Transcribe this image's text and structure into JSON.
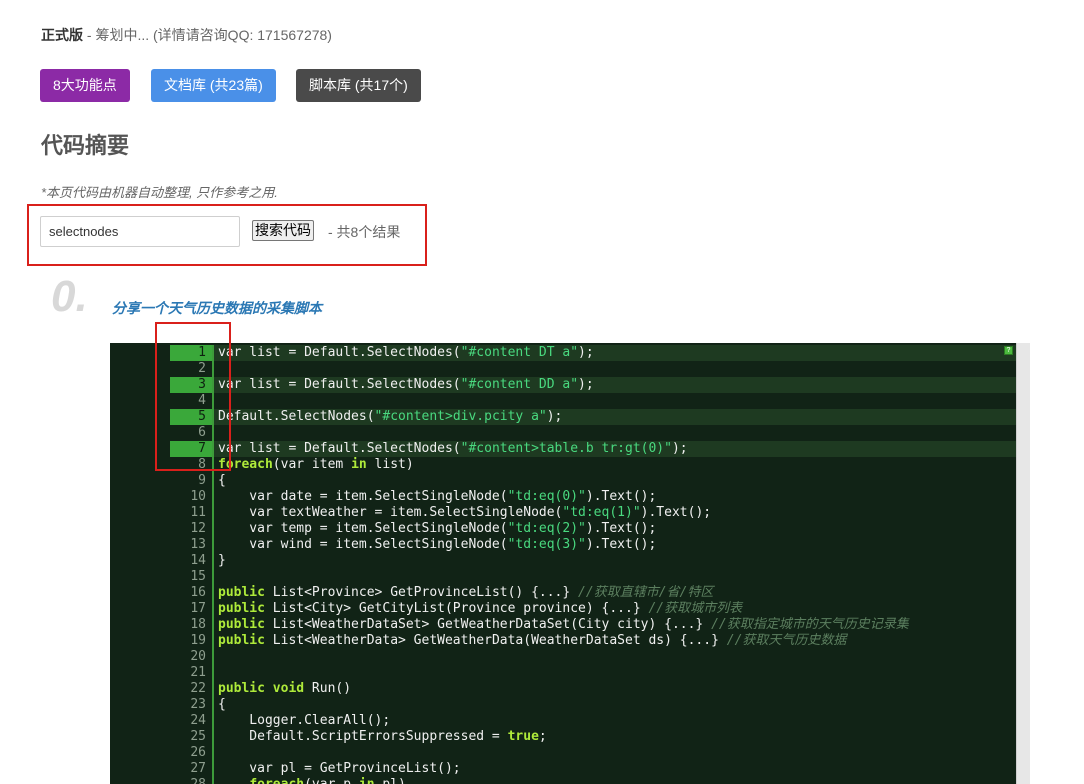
{
  "header": {
    "edition": "正式版",
    "separator": " - ",
    "status": "筹划中... (详情请咨询QQ: 171567278)"
  },
  "buttons": {
    "features": "8大功能点",
    "docs": "文档库 (共23篇)",
    "scripts": "脚本库 (共17个)"
  },
  "section": {
    "title": "代码摘要",
    "note": "*本页代码由机器自动整理, 只作参考之用."
  },
  "search": {
    "value": "selectnodes",
    "button": "搜索代码",
    "result_count": "- 共8个结果"
  },
  "result": {
    "index": "0.",
    "title": "分享一个天气历史数据的采集脚本"
  },
  "colors": {
    "features_btn": "#8c2aa6",
    "docs_btn": "#4a90e8",
    "scripts_btn": "#4a4a4a",
    "code_bg": "#112316",
    "highlight_frame": "#d9201b"
  },
  "code_lines": [
    {
      "n": "1",
      "hl": true,
      "t": [
        [
          "",
          "var list = Default.SelectNodes("
        ],
        [
          "str",
          "\"#content DT a\""
        ],
        [
          "",
          ");"
        ]
      ]
    },
    {
      "n": "2",
      "hl": false,
      "t": []
    },
    {
      "n": "3",
      "hl": true,
      "t": [
        [
          "",
          "var list = Default.SelectNodes("
        ],
        [
          "str",
          "\"#content DD a\""
        ],
        [
          "",
          ");"
        ]
      ]
    },
    {
      "n": "4",
      "hl": false,
      "t": []
    },
    {
      "n": "5",
      "hl": true,
      "t": [
        [
          "",
          "Default.SelectNodes("
        ],
        [
          "str",
          "\"#content>div.pcity a\""
        ],
        [
          "",
          ");"
        ]
      ]
    },
    {
      "n": "6",
      "hl": false,
      "t": []
    },
    {
      "n": "7",
      "hl": true,
      "t": [
        [
          "",
          "var list = Default.SelectNodes("
        ],
        [
          "str",
          "\"#content>table.b tr:gt(0)\""
        ],
        [
          "",
          ");"
        ]
      ]
    },
    {
      "n": "8",
      "hl": false,
      "t": [
        [
          "kw",
          "foreach"
        ],
        [
          "",
          "(var item "
        ],
        [
          "kw",
          "in"
        ],
        [
          "",
          " list)"
        ]
      ]
    },
    {
      "n": "9",
      "hl": false,
      "t": [
        [
          "",
          "{"
        ]
      ]
    },
    {
      "n": "10",
      "hl": false,
      "t": [
        [
          "",
          "    var date = item.SelectSingleNode("
        ],
        [
          "str",
          "\"td:eq(0)\""
        ],
        [
          "",
          ").Text();"
        ]
      ]
    },
    {
      "n": "11",
      "hl": false,
      "t": [
        [
          "",
          "    var textWeather = item.SelectSingleNode("
        ],
        [
          "str",
          "\"td:eq(1)\""
        ],
        [
          "",
          ").Text();"
        ]
      ]
    },
    {
      "n": "12",
      "hl": false,
      "t": [
        [
          "",
          "    var temp = item.SelectSingleNode("
        ],
        [
          "str",
          "\"td:eq(2)\""
        ],
        [
          "",
          ").Text();"
        ]
      ]
    },
    {
      "n": "13",
      "hl": false,
      "t": [
        [
          "",
          "    var wind = item.SelectSingleNode("
        ],
        [
          "str",
          "\"td:eq(3)\""
        ],
        [
          "",
          ").Text();"
        ]
      ]
    },
    {
      "n": "14",
      "hl": false,
      "t": [
        [
          "",
          "}"
        ]
      ]
    },
    {
      "n": "15",
      "hl": false,
      "t": []
    },
    {
      "n": "16",
      "hl": false,
      "t": [
        [
          "kw",
          "public"
        ],
        [
          "",
          " List<Province> GetProvinceList() {...} "
        ],
        [
          "cm",
          "//获取直辖市/省/特区"
        ]
      ]
    },
    {
      "n": "17",
      "hl": false,
      "t": [
        [
          "kw",
          "public"
        ],
        [
          "",
          " List<City> GetCityList(Province province) {...} "
        ],
        [
          "cm",
          "//获取城市列表"
        ]
      ]
    },
    {
      "n": "18",
      "hl": false,
      "t": [
        [
          "kw",
          "public"
        ],
        [
          "",
          " List<WeatherDataSet> GetWeatherDataSet(City city) {...} "
        ],
        [
          "cm",
          "//获取指定城市的天气历史记录集"
        ]
      ]
    },
    {
      "n": "19",
      "hl": false,
      "t": [
        [
          "kw",
          "public"
        ],
        [
          "",
          " List<WeatherData> GetWeatherData(WeatherDataSet ds) {...} "
        ],
        [
          "cm",
          "//获取天气历史数据"
        ]
      ]
    },
    {
      "n": "20",
      "hl": false,
      "t": []
    },
    {
      "n": "21",
      "hl": false,
      "t": []
    },
    {
      "n": "22",
      "hl": false,
      "t": [
        [
          "kw",
          "public void"
        ],
        [
          "",
          " Run()"
        ]
      ]
    },
    {
      "n": "23",
      "hl": false,
      "t": [
        [
          "",
          "{"
        ]
      ]
    },
    {
      "n": "24",
      "hl": false,
      "t": [
        [
          "",
          "    Logger.ClearAll();"
        ]
      ]
    },
    {
      "n": "25",
      "hl": false,
      "t": [
        [
          "",
          "    Default.ScriptErrorsSuppressed = "
        ],
        [
          "kw",
          "true"
        ],
        [
          "",
          ";"
        ]
      ]
    },
    {
      "n": "26",
      "hl": false,
      "t": []
    },
    {
      "n": "27",
      "hl": false,
      "t": [
        [
          "",
          "    var pl = GetProvinceList();"
        ]
      ]
    },
    {
      "n": "28",
      "hl": false,
      "t": [
        [
          "",
          "    "
        ],
        [
          "kw",
          "foreach"
        ],
        [
          "",
          "(var p "
        ],
        [
          "kw",
          "in"
        ],
        [
          "",
          " pl)"
        ]
      ]
    }
  ]
}
